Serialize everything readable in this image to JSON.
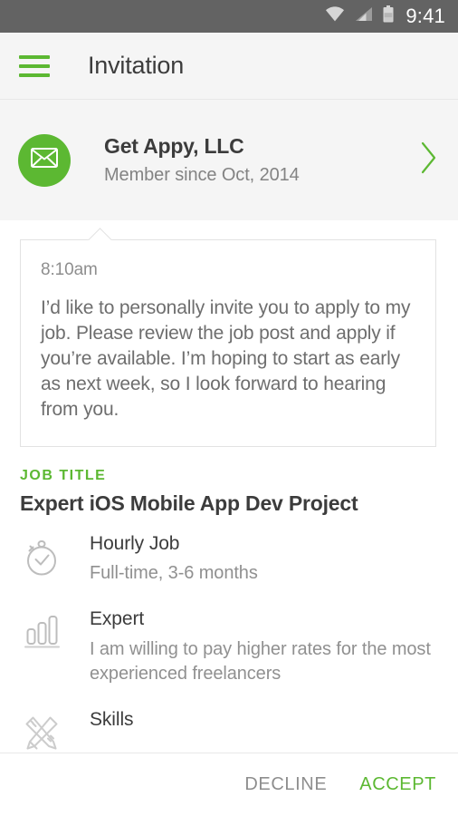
{
  "status_bar": {
    "time": "9:41",
    "icons": [
      "wifi-icon",
      "cellular-signal-icon",
      "battery-icon"
    ],
    "background_color": "#636363"
  },
  "app_bar": {
    "menu_icon": "hamburger-menu-icon",
    "title": "Invitation",
    "accent_color": "#5cb832"
  },
  "profile": {
    "avatar_icon": "envelope-icon",
    "name": "Get Appy, LLC",
    "subtitle": "Member since Oct, 2014",
    "chevron_icon": "chevron-right-icon"
  },
  "message": {
    "time": "8:10am",
    "body": "I’d like to personally invite you to apply to my job. Please review the job post and apply if you’re available. I’m hoping to start as early as next week, so I look forward to hearing from you."
  },
  "job": {
    "section_label": "JOB TITLE",
    "title": "Expert iOS Mobile App Dev Project",
    "details": [
      {
        "icon": "stopwatch-icon",
        "title": "Hourly Job",
        "subtitle": "Full-time, 3-6 months"
      },
      {
        "icon": "bar-chart-icon",
        "title": "Expert",
        "subtitle": "I am willing to pay higher rates for the most experienced freelancers"
      },
      {
        "icon": "pencil-ruler-icon",
        "title": "Skills",
        "subtitle": ""
      }
    ]
  },
  "actions": {
    "decline_label": "DECLINE",
    "accept_label": "ACCEPT",
    "decline_color": "#8e8e8e",
    "accept_color": "#5cb832"
  }
}
